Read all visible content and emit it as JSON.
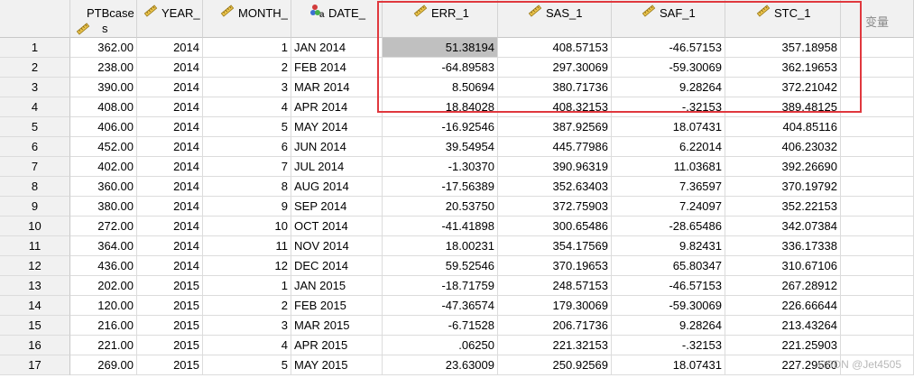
{
  "columns": [
    {
      "key": "ptb",
      "label_line1": "PTBcase",
      "label_line2": "s",
      "icon": "ruler-icon"
    },
    {
      "key": "year",
      "label_line1": "YEAR_",
      "icon": "ruler-icon"
    },
    {
      "key": "month",
      "label_line1": "MONTH_",
      "icon": "ruler-icon"
    },
    {
      "key": "date",
      "label_line1": "DATE_",
      "icon": "nominal-string-icon"
    },
    {
      "key": "err",
      "label_line1": "ERR_1",
      "icon": "ruler-icon"
    },
    {
      "key": "sas",
      "label_line1": "SAS_1",
      "icon": "ruler-icon"
    },
    {
      "key": "saf",
      "label_line1": "SAF_1",
      "icon": "ruler-icon"
    },
    {
      "key": "stc",
      "label_line1": "STC_1",
      "icon": "ruler-icon"
    }
  ],
  "extra_header_label": "变量",
  "rows": [
    {
      "n": "1",
      "ptb": "362.00",
      "year": "2014",
      "month": "1",
      "date": "JAN 2014",
      "err": "51.38194",
      "sas": "408.57153",
      "saf": "-46.57153",
      "stc": "357.18958"
    },
    {
      "n": "2",
      "ptb": "238.00",
      "year": "2014",
      "month": "2",
      "date": "FEB 2014",
      "err": "-64.89583",
      "sas": "297.30069",
      "saf": "-59.30069",
      "stc": "362.19653"
    },
    {
      "n": "3",
      "ptb": "390.00",
      "year": "2014",
      "month": "3",
      "date": "MAR 2014",
      "err": "8.50694",
      "sas": "380.71736",
      "saf": "9.28264",
      "stc": "372.21042"
    },
    {
      "n": "4",
      "ptb": "408.00",
      "year": "2014",
      "month": "4",
      "date": "APR 2014",
      "err": "18.84028",
      "sas": "408.32153",
      "saf": "-.32153",
      "stc": "389.48125"
    },
    {
      "n": "5",
      "ptb": "406.00",
      "year": "2014",
      "month": "5",
      "date": "MAY 2014",
      "err": "-16.92546",
      "sas": "387.92569",
      "saf": "18.07431",
      "stc": "404.85116"
    },
    {
      "n": "6",
      "ptb": "452.00",
      "year": "2014",
      "month": "6",
      "date": "JUN 2014",
      "err": "39.54954",
      "sas": "445.77986",
      "saf": "6.22014",
      "stc": "406.23032"
    },
    {
      "n": "7",
      "ptb": "402.00",
      "year": "2014",
      "month": "7",
      "date": "JUL 2014",
      "err": "-1.30370",
      "sas": "390.96319",
      "saf": "11.03681",
      "stc": "392.26690"
    },
    {
      "n": "8",
      "ptb": "360.00",
      "year": "2014",
      "month": "8",
      "date": "AUG 2014",
      "err": "-17.56389",
      "sas": "352.63403",
      "saf": "7.36597",
      "stc": "370.19792"
    },
    {
      "n": "9",
      "ptb": "380.00",
      "year": "2014",
      "month": "9",
      "date": "SEP 2014",
      "err": "20.53750",
      "sas": "372.75903",
      "saf": "7.24097",
      "stc": "352.22153"
    },
    {
      "n": "10",
      "ptb": "272.00",
      "year": "2014",
      "month": "10",
      "date": "OCT 2014",
      "err": "-41.41898",
      "sas": "300.65486",
      "saf": "-28.65486",
      "stc": "342.07384"
    },
    {
      "n": "11",
      "ptb": "364.00",
      "year": "2014",
      "month": "11",
      "date": "NOV 2014",
      "err": "18.00231",
      "sas": "354.17569",
      "saf": "9.82431",
      "stc": "336.17338"
    },
    {
      "n": "12",
      "ptb": "436.00",
      "year": "2014",
      "month": "12",
      "date": "DEC 2014",
      "err": "59.52546",
      "sas": "370.19653",
      "saf": "65.80347",
      "stc": "310.67106"
    },
    {
      "n": "13",
      "ptb": "202.00",
      "year": "2015",
      "month": "1",
      "date": "JAN 2015",
      "err": "-18.71759",
      "sas": "248.57153",
      "saf": "-46.57153",
      "stc": "267.28912"
    },
    {
      "n": "14",
      "ptb": "120.00",
      "year": "2015",
      "month": "2",
      "date": "FEB 2015",
      "err": "-47.36574",
      "sas": "179.30069",
      "saf": "-59.30069",
      "stc": "226.66644"
    },
    {
      "n": "15",
      "ptb": "216.00",
      "year": "2015",
      "month": "3",
      "date": "MAR 2015",
      "err": "-6.71528",
      "sas": "206.71736",
      "saf": "9.28264",
      "stc": "213.43264"
    },
    {
      "n": "16",
      "ptb": "221.00",
      "year": "2015",
      "month": "4",
      "date": "APR 2015",
      "err": ".06250",
      "sas": "221.32153",
      "saf": "-.32153",
      "stc": "221.25903"
    },
    {
      "n": "17",
      "ptb": "269.00",
      "year": "2015",
      "month": "5",
      "date": "MAY 2015",
      "err": "23.63009",
      "sas": "250.92569",
      "saf": "18.07431",
      "stc": "227.29560"
    }
  ],
  "selected_cell": {
    "row": "1",
    "column": "err"
  },
  "highlight_color": "#e0383e",
  "watermark": "CSDN @Jet4505"
}
